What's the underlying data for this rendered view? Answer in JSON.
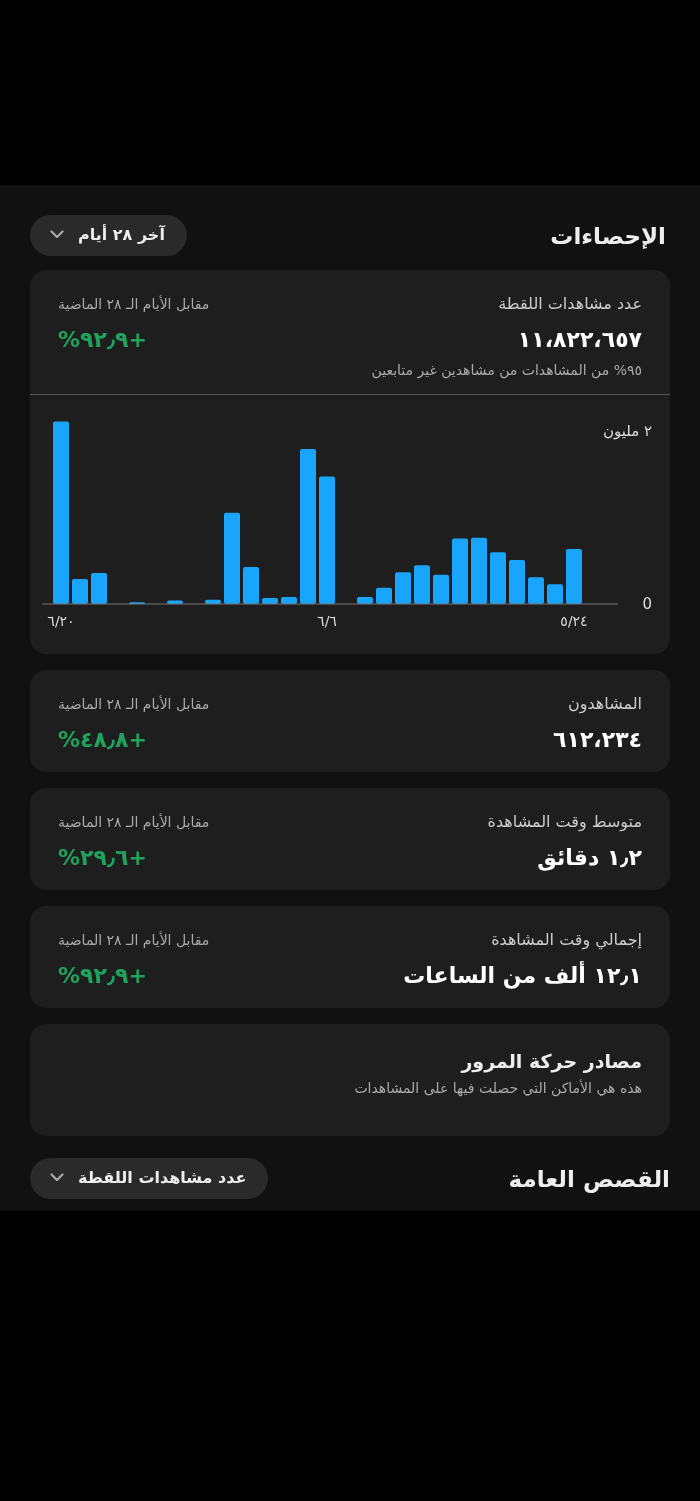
{
  "header": {
    "title": "الإحصاءات",
    "range_button": "آخر ٢٨ أيام"
  },
  "metrics": [
    {
      "kind": "chart",
      "title": "عدد مشاهدات اللقطة",
      "value": "١١،٨٢٢،٦٥٧",
      "note": "٩٥% من المشاهدات من مشاهدين غير متابعين",
      "comparison_label": "مقابل الأيام الـ ٢٨ الماضية",
      "change": "+٩٢٫٩%",
      "chart_data": {
        "type": "bar",
        "orientation": "vertical",
        "categories": [
          "٦/٢٠",
          null,
          null,
          null,
          null,
          null,
          null,
          null,
          null,
          null,
          null,
          null,
          null,
          null,
          "٦/٦",
          null,
          null,
          null,
          null,
          null,
          null,
          null,
          null,
          null,
          null,
          null,
          null,
          "٥/٢٤"
        ],
        "series": [
          {
            "color": "#18a5fb",
            "values": [
              2.12,
              0.29,
              0.36,
              0,
              0.02,
              0,
              0.04,
              0,
              0.05,
              1.06,
              0.43,
              0.07,
              0.08,
              1.8,
              1.48,
              0,
              0.08,
              0.19,
              0.37,
              0.45,
              0.34,
              0.76,
              0.77,
              0.6,
              0.51,
              0.31,
              0.23,
              0.64
            ]
          }
        ],
        "yticks": [
          {
            "value": 0,
            "label": "0"
          },
          {
            "value": 2,
            "label": "٢ مليون"
          }
        ],
        "ylim": [
          0,
          2.44
        ]
      }
    },
    {
      "kind": "plain",
      "title": "المشاهدون",
      "value": "٦١٢،٢٣٤",
      "comparison_label": "مقابل الأيام الـ ٢٨ الماضية",
      "change": "+٤٨٫٨%"
    },
    {
      "kind": "plain",
      "title": "متوسط وقت المشاهدة",
      "value": "١٫٢ دقائق",
      "comparison_label": "مقابل الأيام الـ ٢٨ الماضية",
      "change": "+٢٩٫٦%"
    },
    {
      "kind": "plain",
      "title": "إجمالي وقت المشاهدة",
      "value": "١٢٫١ ألف من الساعات",
      "comparison_label": "مقابل الأيام الـ ٢٨ الماضية",
      "change": "+٩٢٫٩%"
    }
  ],
  "traffic_sources": {
    "title": "مصادر حركة المرور",
    "subtitle": "هذه هي الأماكن التي حصلت فيها على المشاهدات"
  },
  "public_stories": {
    "title": "القصص العامة",
    "sort_button": "عدد مشاهدات اللقطة"
  }
}
